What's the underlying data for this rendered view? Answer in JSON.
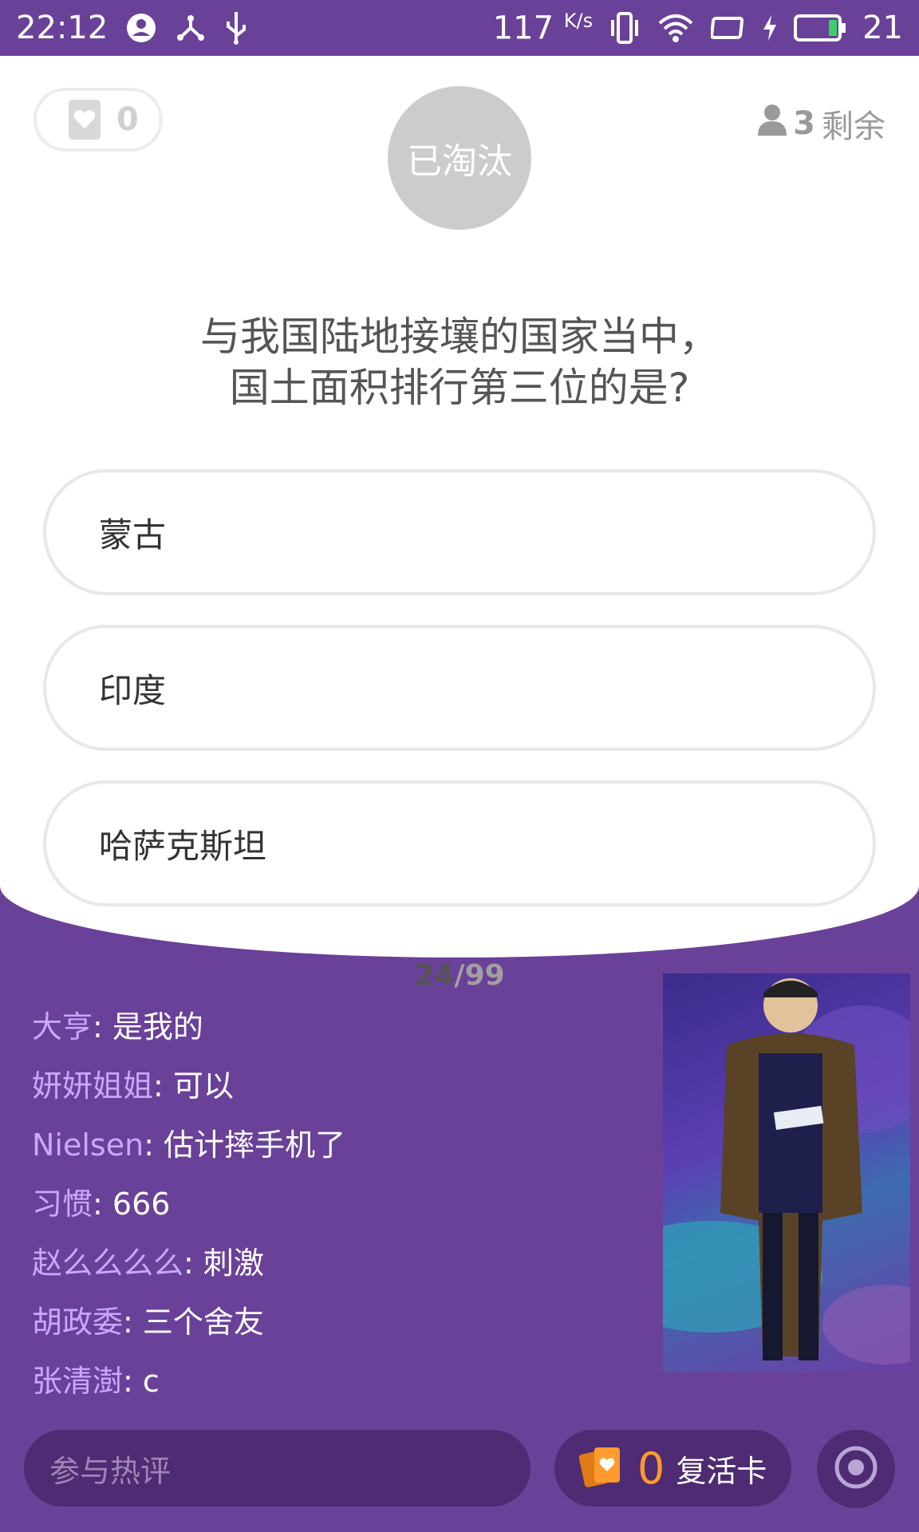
{
  "status_bar": {
    "time": "22:12",
    "speed_value": "117",
    "speed_unit": "K/s",
    "battery_level": "21"
  },
  "game": {
    "lives": "0",
    "eliminated_label": "已淘汰",
    "remaining_count": "3",
    "remaining_label": "剩余",
    "question_line1": "与我国陆地接壤的国家当中，",
    "question_line2": "国土面积排行第三位的是?",
    "options": [
      {
        "label": "蒙古"
      },
      {
        "label": "印度"
      },
      {
        "label": "哈萨克斯坦"
      }
    ],
    "progress_current": "24",
    "progress_total": "/99"
  },
  "comments": [
    {
      "user": "大亨",
      "msg": ": 是我的"
    },
    {
      "user": "妍妍姐姐",
      "msg": ": 可以"
    },
    {
      "user": "Nielsen",
      "msg": ": 估计摔手机了"
    },
    {
      "user": "习惯",
      "msg": ": 666"
    },
    {
      "user": "赵么么么么",
      "msg": ": 刺激"
    },
    {
      "user": "胡政委",
      "msg": ": 三个舍友"
    },
    {
      "user": "张清澍",
      "msg": ": c"
    }
  ],
  "bottom": {
    "comment_placeholder": "参与热评",
    "revive_count": "0",
    "revive_label": "复活卡"
  },
  "colors": {
    "background": "#6a4199",
    "accent_orange": "#ff9a2e",
    "comment_user": "#c9a8ff"
  },
  "icons": [
    "account-circle-icon",
    "nfc-share-icon",
    "usb-icon",
    "vibrate-icon",
    "wifi-icon",
    "screen-rotate-icon",
    "charging-icon",
    "battery-icon",
    "heart-icon",
    "person-icon",
    "revive-card-icon",
    "target-icon"
  ]
}
